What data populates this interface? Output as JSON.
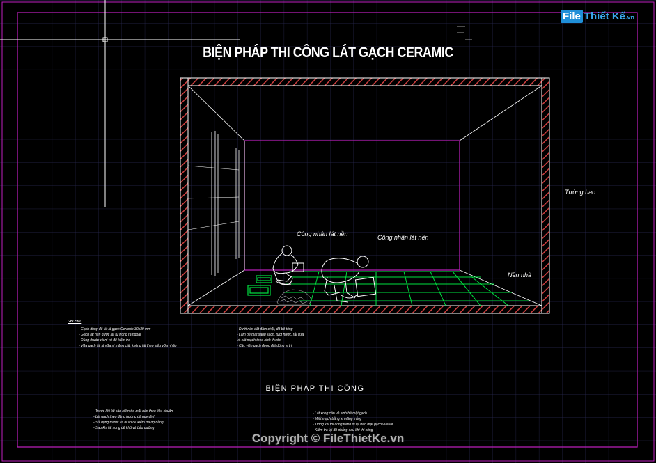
{
  "drawing": {
    "title": "BIỆN PHÁP THI CÔNG LÁT GẠCH CERAMIC",
    "subtitle": "BIỆN PHÁP THI CÔNG",
    "labels": {
      "worker_1": "Công nhân lát nền",
      "worker_2": "Công nhân lát nền",
      "wall": "Tường bao",
      "floor": "Nền nhà"
    },
    "notes_heading": "Ghi chú:",
    "notes_left_col1": [
      "- Gạch dùng để lát là gạch Ceramic 30x30 mm",
      "- Gạch lát nền được lát từ trong ra ngoài,",
      "- Dùng thước và ni vô để kiểm tra",
      "- Vữa gạch lát là vữa xi măng cát, không lát theo kiểu vữa nhão"
    ],
    "notes_left_col2": [
      "- Dưới nền đất đầm chặt, đổ bê tông",
      "- Làm bề mặt sàng sạch, tưới nước, rải vữa",
      "  và cắt mạch theo kích thước",
      "- Các viên gạch được đặt đúng vị trí"
    ],
    "notes_bottom_col1": [
      "- Trước khi lát cần kiểm tra mặt nền theo tiêu chuẩn",
      "- Lát gạch theo đúng hướng đã quy định",
      "- Sử dụng thước và ni vô để kiểm tra độ bằng",
      "- Sau khi lát xong để khô và bảo dưỡng"
    ],
    "notes_bottom_col2": [
      "- Lát xong cần vệ sinh bề mặt gạch",
      "- Miết mạch bằng xi măng trắng",
      "- Trong khi thi công tránh đi lại trên mặt gạch vừa lát",
      "- Kiểm tra lại độ phẳng sau khi thi công"
    ],
    "copyright": "Copyright © FileThietKe.vn"
  },
  "logo": {
    "box": "File",
    "text": "Thiết Kế",
    "suffix": ".vn"
  },
  "colors": {
    "background": "#000000",
    "grid": "#2a2a55",
    "frame": "#c020c0",
    "tile": "#00e040",
    "hatch": "#d04040",
    "logo_blue": "#1f8fd8"
  }
}
